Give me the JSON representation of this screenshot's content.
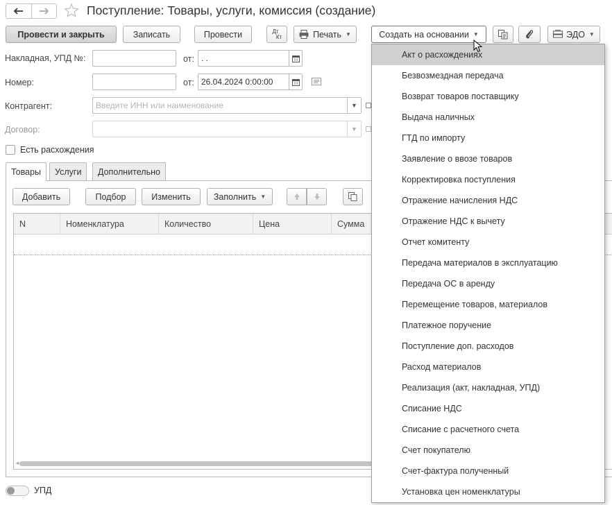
{
  "window": {
    "title": "Поступление: Товары, услуги, комиссия (создание)"
  },
  "nav": {
    "back_icon": "arrow-left-icon",
    "forward_icon": "arrow-right-icon",
    "favorite_icon": "star-icon"
  },
  "toolbar": {
    "post_close": "Провести и закрыть",
    "save": "Записать",
    "post": "Провести",
    "dt_kt_top": "Дт",
    "dt_kt_bottom": "Кт",
    "print": "Печать",
    "create_based": "Создать на основании",
    "edo": "ЭДО"
  },
  "form": {
    "invoice_label": "Накладная, УПД №:",
    "invoice_value": "",
    "from_label": "от:",
    "invoice_date": " .  .",
    "number_label": "Номер:",
    "number_value": "",
    "date_value": "26.04.2024  0:00:00",
    "counterparty_label": "Контрагент:",
    "counterparty_placeholder": "Введите ИНН или наименование",
    "contract_label": "Договор:",
    "contract_value": "",
    "discrepancy_label": "Есть расхождения",
    "discrepancy_checked": false
  },
  "tabs": [
    "Товары",
    "Услуги",
    "Дополнительно"
  ],
  "table_toolbar": {
    "add": "Добавить",
    "pick": "Подбор",
    "edit": "Изменить",
    "fill": "Заполнить"
  },
  "table": {
    "columns": [
      "N",
      "Номенклатура",
      "Количество",
      "Цена",
      "Сумма"
    ],
    "rows": []
  },
  "footer": {
    "upd_toggle_label": "УПД",
    "upd_toggle_on": false
  },
  "dropdown": {
    "items": [
      "Акт о расхождениях",
      "Безвозмездная передача",
      "Возврат товаров поставщику",
      "Выдача наличных",
      "ГТД по импорту",
      "Заявление о ввозе товаров",
      "Корректировка поступления",
      "Отражение начисления НДС",
      "Отражение НДС к вычету",
      "Отчет комитенту",
      "Передача материалов в эксплуатацию",
      "Передача ОС в аренду",
      "Перемещение товаров, материалов",
      "Платежное поручение",
      "Поступление доп. расходов",
      "Расход материалов",
      "Реализация (акт, накладная, УПД)",
      "Списание НДС",
      "Списание с расчетного счета",
      "Счет покупателю",
      "Счет-фактура полученный",
      "Установка цен номенклатуры"
    ],
    "highlighted_index": 0
  },
  "colors": {
    "highlight": "#d0d0d0",
    "border": "#b0b0b0",
    "text": "#333333"
  }
}
